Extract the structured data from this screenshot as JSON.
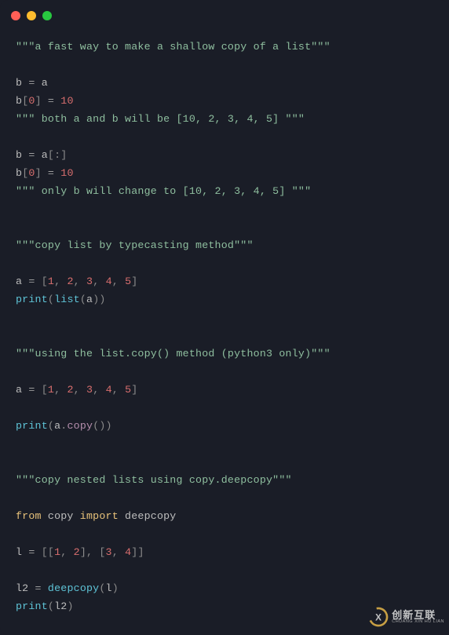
{
  "window": {
    "traffic_lights": [
      "close",
      "minimize",
      "maximize"
    ]
  },
  "code": {
    "lines": [
      {
        "t": [
          {
            "c": "tok-str",
            "v": "\"\"\"a fast way to make a shallow copy of a list\"\"\""
          }
        ]
      },
      {
        "t": []
      },
      {
        "t": [
          {
            "c": "tok-ident",
            "v": "b "
          },
          {
            "c": "tok-op",
            "v": "="
          },
          {
            "c": "tok-ident",
            "v": " a"
          }
        ]
      },
      {
        "t": [
          {
            "c": "tok-ident",
            "v": "b"
          },
          {
            "c": "tok-punc",
            "v": "["
          },
          {
            "c": "tok-num",
            "v": "0"
          },
          {
            "c": "tok-punc",
            "v": "] "
          },
          {
            "c": "tok-op",
            "v": "="
          },
          {
            "c": "tok-ident",
            "v": " "
          },
          {
            "c": "tok-num",
            "v": "10"
          }
        ]
      },
      {
        "t": [
          {
            "c": "tok-str",
            "v": "\"\"\" both a and b will be [10, 2, 3, 4, 5] \"\"\""
          }
        ]
      },
      {
        "t": []
      },
      {
        "t": [
          {
            "c": "tok-ident",
            "v": "b "
          },
          {
            "c": "tok-op",
            "v": "="
          },
          {
            "c": "tok-ident",
            "v": " a"
          },
          {
            "c": "tok-punc",
            "v": "[:]"
          }
        ]
      },
      {
        "t": [
          {
            "c": "tok-ident",
            "v": "b"
          },
          {
            "c": "tok-punc",
            "v": "["
          },
          {
            "c": "tok-num",
            "v": "0"
          },
          {
            "c": "tok-punc",
            "v": "] "
          },
          {
            "c": "tok-op",
            "v": "="
          },
          {
            "c": "tok-ident",
            "v": " "
          },
          {
            "c": "tok-num",
            "v": "10"
          }
        ]
      },
      {
        "t": [
          {
            "c": "tok-str",
            "v": "\"\"\" only b will change to [10, 2, 3, 4, 5] \"\"\""
          }
        ]
      },
      {
        "t": []
      },
      {
        "t": []
      },
      {
        "t": [
          {
            "c": "tok-str",
            "v": "\"\"\"copy list by typecasting method\"\"\""
          }
        ]
      },
      {
        "t": []
      },
      {
        "t": [
          {
            "c": "tok-ident",
            "v": "a "
          },
          {
            "c": "tok-op",
            "v": "="
          },
          {
            "c": "tok-ident",
            "v": " "
          },
          {
            "c": "tok-punc",
            "v": "["
          },
          {
            "c": "tok-num",
            "v": "1"
          },
          {
            "c": "tok-punc",
            "v": ", "
          },
          {
            "c": "tok-num",
            "v": "2"
          },
          {
            "c": "tok-punc",
            "v": ", "
          },
          {
            "c": "tok-num",
            "v": "3"
          },
          {
            "c": "tok-punc",
            "v": ", "
          },
          {
            "c": "tok-num",
            "v": "4"
          },
          {
            "c": "tok-punc",
            "v": ", "
          },
          {
            "c": "tok-num",
            "v": "5"
          },
          {
            "c": "tok-punc",
            "v": "]"
          }
        ]
      },
      {
        "t": [
          {
            "c": "tok-builtin",
            "v": "print"
          },
          {
            "c": "tok-punc",
            "v": "("
          },
          {
            "c": "tok-builtin",
            "v": "list"
          },
          {
            "c": "tok-punc",
            "v": "("
          },
          {
            "c": "tok-ident",
            "v": "a"
          },
          {
            "c": "tok-punc",
            "v": "))"
          }
        ]
      },
      {
        "t": []
      },
      {
        "t": []
      },
      {
        "t": [
          {
            "c": "tok-str",
            "v": "\"\"\"using the list.copy() method (python3 only)\"\"\""
          }
        ]
      },
      {
        "t": []
      },
      {
        "t": [
          {
            "c": "tok-ident",
            "v": "a "
          },
          {
            "c": "tok-op",
            "v": "="
          },
          {
            "c": "tok-ident",
            "v": " "
          },
          {
            "c": "tok-punc",
            "v": "["
          },
          {
            "c": "tok-num",
            "v": "1"
          },
          {
            "c": "tok-punc",
            "v": ", "
          },
          {
            "c": "tok-num",
            "v": "2"
          },
          {
            "c": "tok-punc",
            "v": ", "
          },
          {
            "c": "tok-num",
            "v": "3"
          },
          {
            "c": "tok-punc",
            "v": ", "
          },
          {
            "c": "tok-num",
            "v": "4"
          },
          {
            "c": "tok-punc",
            "v": ", "
          },
          {
            "c": "tok-num",
            "v": "5"
          },
          {
            "c": "tok-punc",
            "v": "]"
          }
        ]
      },
      {
        "t": []
      },
      {
        "t": [
          {
            "c": "tok-builtin",
            "v": "print"
          },
          {
            "c": "tok-punc",
            "v": "("
          },
          {
            "c": "tok-ident",
            "v": "a"
          },
          {
            "c": "tok-punc",
            "v": "."
          },
          {
            "c": "tok-method",
            "v": "copy"
          },
          {
            "c": "tok-punc",
            "v": "())"
          }
        ]
      },
      {
        "t": []
      },
      {
        "t": []
      },
      {
        "t": [
          {
            "c": "tok-str",
            "v": "\"\"\"copy nested lists using copy.deepcopy\"\"\""
          }
        ]
      },
      {
        "t": []
      },
      {
        "t": [
          {
            "c": "tok-kw",
            "v": "from"
          },
          {
            "c": "tok-ident",
            "v": " copy "
          },
          {
            "c": "tok-kw",
            "v": "import"
          },
          {
            "c": "tok-ident",
            "v": " deepcopy"
          }
        ]
      },
      {
        "t": []
      },
      {
        "t": [
          {
            "c": "tok-ident",
            "v": "l "
          },
          {
            "c": "tok-op",
            "v": "="
          },
          {
            "c": "tok-ident",
            "v": " "
          },
          {
            "c": "tok-punc",
            "v": "[["
          },
          {
            "c": "tok-num",
            "v": "1"
          },
          {
            "c": "tok-punc",
            "v": ", "
          },
          {
            "c": "tok-num",
            "v": "2"
          },
          {
            "c": "tok-punc",
            "v": "], ["
          },
          {
            "c": "tok-num",
            "v": "3"
          },
          {
            "c": "tok-punc",
            "v": ", "
          },
          {
            "c": "tok-num",
            "v": "4"
          },
          {
            "c": "tok-punc",
            "v": "]]"
          }
        ]
      },
      {
        "t": []
      },
      {
        "t": [
          {
            "c": "tok-ident",
            "v": "l2 "
          },
          {
            "c": "tok-op",
            "v": "="
          },
          {
            "c": "tok-ident",
            "v": " "
          },
          {
            "c": "tok-func",
            "v": "deepcopy"
          },
          {
            "c": "tok-punc",
            "v": "("
          },
          {
            "c": "tok-ident",
            "v": "l"
          },
          {
            "c": "tok-punc",
            "v": ")"
          }
        ]
      },
      {
        "t": [
          {
            "c": "tok-builtin",
            "v": "print"
          },
          {
            "c": "tok-punc",
            "v": "("
          },
          {
            "c": "tok-ident",
            "v": "l2"
          },
          {
            "c": "tok-punc",
            "v": ")"
          }
        ]
      }
    ]
  },
  "watermark": {
    "cn_text": "创新互联",
    "en_text": "CHUANG XIN HU LIAN",
    "logo_letter": "X"
  }
}
